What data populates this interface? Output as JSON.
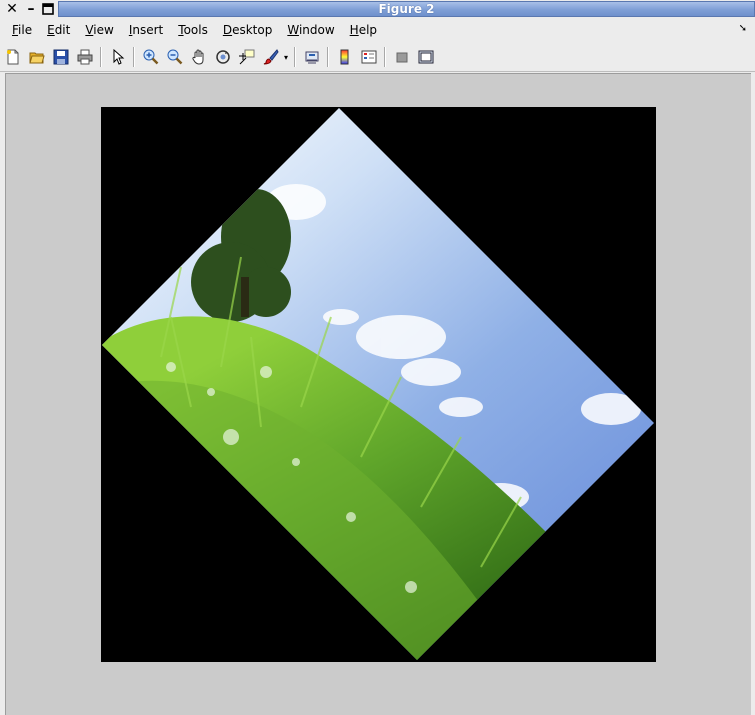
{
  "window": {
    "title": "Figure 2",
    "controls": [
      "close-icon",
      "minimize-icon",
      "maximize-icon"
    ]
  },
  "menu": {
    "items": [
      {
        "key": "F",
        "rest": "ile"
      },
      {
        "key": "E",
        "rest": "dit"
      },
      {
        "key": "V",
        "rest": "iew"
      },
      {
        "key": "I",
        "rest": "nsert"
      },
      {
        "key": "T",
        "rest": "ools"
      },
      {
        "key": "D",
        "rest": "esktop"
      },
      {
        "key": "W",
        "rest": "indow"
      },
      {
        "key": "H",
        "rest": "elp"
      }
    ]
  },
  "toolbar": {
    "icons": [
      "new-figure-icon",
      "open-file-icon",
      "save-icon",
      "print-icon",
      "pointer-icon",
      "zoom-in-icon",
      "zoom-out-icon",
      "pan-icon",
      "rotate-3d-icon",
      "data-cursor-icon",
      "brush-icon",
      "link-plot-icon",
      "colorbar-icon",
      "legend-icon",
      "hide-plot-tools-icon",
      "show-plot-tools-icon"
    ]
  },
  "figure": {
    "image_content": "rotated photo of grass and blue sky with clouds and a tree",
    "background_color": "#000000",
    "canvas_color": "#cbcbcb",
    "title_bar_color": "#7f9fd6"
  }
}
